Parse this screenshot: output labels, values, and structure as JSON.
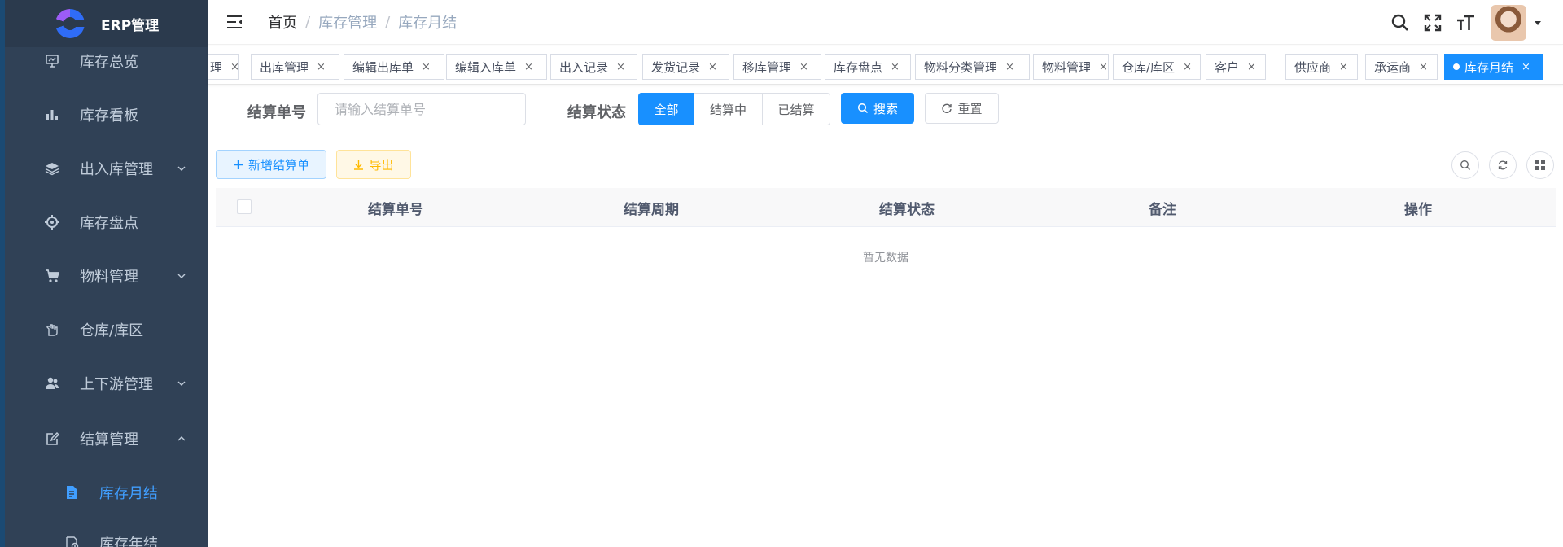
{
  "app": {
    "title": "ERP管理"
  },
  "sidebar": {
    "items": [
      {
        "label": "库存总览",
        "icon": "monitor-icon",
        "has_children": false
      },
      {
        "label": "库存看板",
        "icon": "bar-chart-icon",
        "has_children": false
      },
      {
        "label": "出入库管理",
        "icon": "layers-icon",
        "has_children": true,
        "expanded": false
      },
      {
        "label": "库存盘点",
        "icon": "target-icon",
        "has_children": false
      },
      {
        "label": "物料管理",
        "icon": "cart-icon",
        "has_children": true,
        "expanded": false
      },
      {
        "label": "仓库/库区",
        "icon": "hand-icon",
        "has_children": false
      },
      {
        "label": "上下游管理",
        "icon": "people-icon",
        "has_children": true,
        "expanded": false
      },
      {
        "label": "结算管理",
        "icon": "edit-icon",
        "has_children": true,
        "expanded": true
      }
    ],
    "sub_items": [
      {
        "label": "库存月结",
        "icon": "document-icon",
        "active": true
      },
      {
        "label": "库存年结",
        "icon": "stamp-icon",
        "active": false
      }
    ]
  },
  "breadcrumb": [
    "首页",
    "库存管理",
    "库存月结"
  ],
  "tags": [
    {
      "label": "理",
      "active": false
    },
    {
      "label": "出库管理",
      "active": false
    },
    {
      "label": "编辑出库单",
      "active": false
    },
    {
      "label": "编辑入库单",
      "active": false
    },
    {
      "label": "出入记录",
      "active": false
    },
    {
      "label": "发货记录",
      "active": false
    },
    {
      "label": "移库管理",
      "active": false
    },
    {
      "label": "库存盘点",
      "active": false
    },
    {
      "label": "物料分类管理",
      "active": false
    },
    {
      "label": "物料管理",
      "active": false
    },
    {
      "label": "仓库/库区",
      "active": false
    },
    {
      "label": "客户",
      "active": false
    },
    {
      "label": "供应商",
      "active": false
    },
    {
      "label": "承运商",
      "active": false
    },
    {
      "label": "库存月结",
      "active": true
    }
  ],
  "search": {
    "settle_no_label": "结算单号",
    "settle_no_placeholder": "请输入结算单号",
    "settle_no_value": "",
    "status_label": "结算状态",
    "status_options": [
      {
        "label": "全部",
        "selected": true
      },
      {
        "label": "结算中",
        "selected": false
      },
      {
        "label": "已结算",
        "selected": false
      }
    ],
    "search_button": "搜索",
    "reset_button": "重置"
  },
  "toolbar": {
    "add_button": "新增结算单",
    "export_button": "导出"
  },
  "table": {
    "columns": [
      "结算单号",
      "结算周期",
      "结算状态",
      "备注",
      "操作"
    ],
    "rows": [],
    "empty_text": "暂无数据"
  },
  "colors": {
    "primary": "#1890ff",
    "sidebar_bg": "#304156",
    "sidebar_text": "#bfcbd9",
    "menu_active": "#409eff",
    "warning": "#ffba00"
  }
}
